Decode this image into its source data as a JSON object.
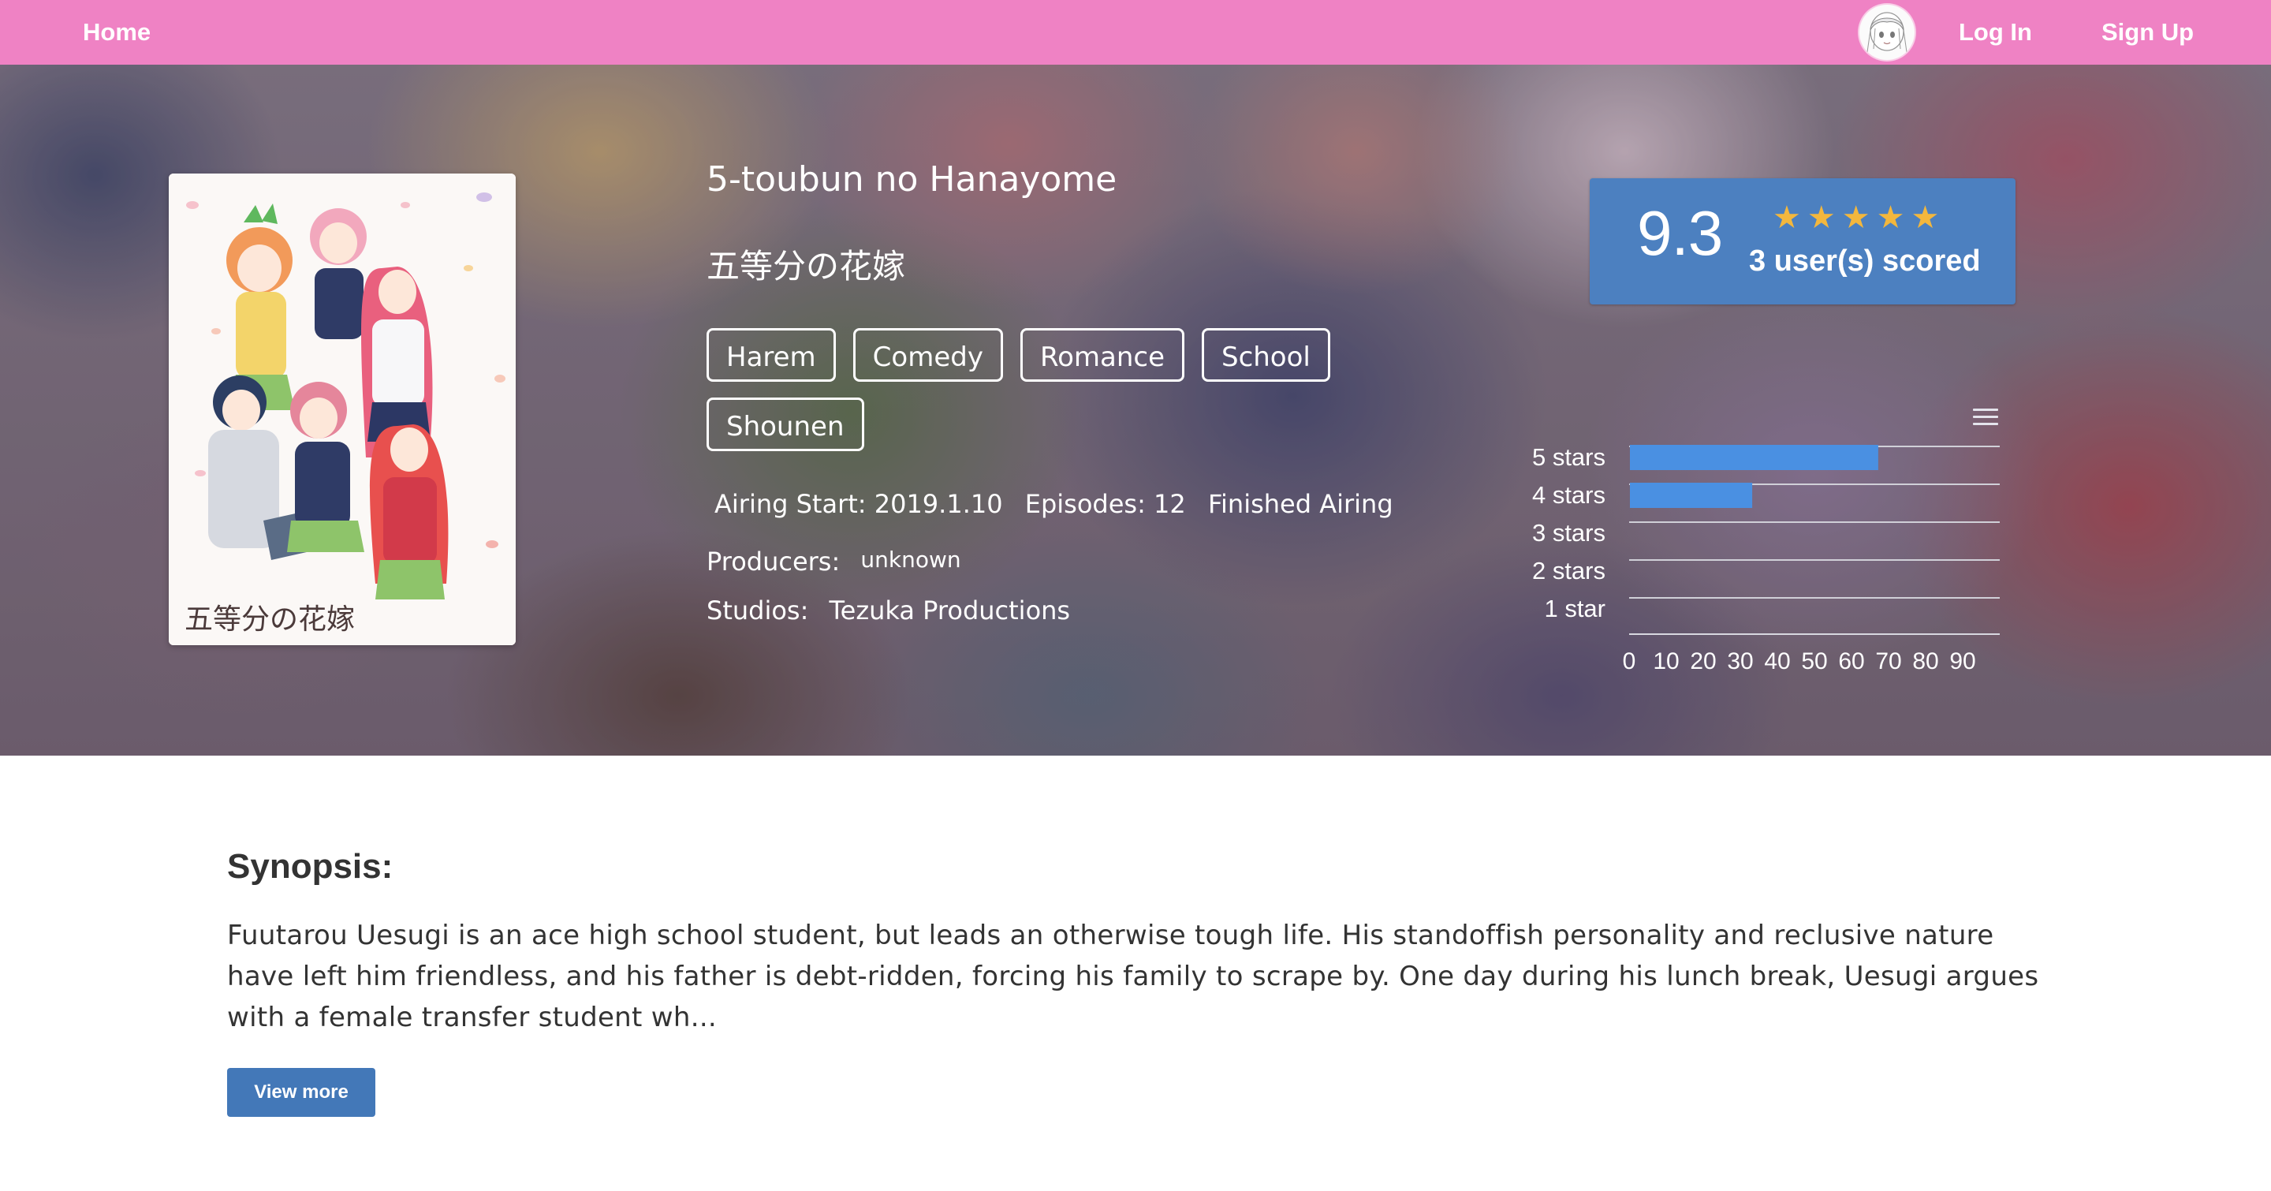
{
  "nav": {
    "home": "Home",
    "login": "Log In",
    "signup": "Sign Up"
  },
  "anime": {
    "title_en": "5-toubun no Hanayome",
    "title_jp": "五等分の花嫁",
    "poster_caption": "五等分の花嫁",
    "genres": [
      "Harem",
      "Comedy",
      "Romance",
      "School",
      "Shounen"
    ],
    "airing_start": "Airing Start: 2019.1.10",
    "episodes": "Episodes: 12",
    "status": "Finished Airing",
    "producers_label": "Producers:",
    "producers_value": "unknown",
    "studios_label": "Studios:",
    "studios_value": "Tezuka Productions"
  },
  "score": {
    "value": "9.3",
    "users": "3 user(s) scored",
    "stars": 5
  },
  "chart_data": {
    "type": "bar",
    "orientation": "horizontal",
    "categories": [
      "5 stars",
      "4 stars",
      "3 stars",
      "2 stars",
      "1 star"
    ],
    "values": [
      67,
      33,
      0,
      0,
      0
    ],
    "xticks": [
      "0",
      "10",
      "20",
      "30",
      "40",
      "50",
      "60",
      "70",
      "80",
      "90"
    ],
    "xlim": [
      0,
      100
    ],
    "grid": true,
    "color": "#4a90e2"
  },
  "synopsis": {
    "heading": "Synopsis:",
    "text": "Fuutarou Uesugi is an ace high school student, but leads an otherwise tough life. His standoffish personality and reclusive nature have left him friendless, and his father is debt-ridden, forcing his family to scrape by. One day during his lunch break, Uesugi argues with a female transfer student wh...",
    "button": "View more"
  },
  "colors": {
    "nav_bg": "#ef82c4",
    "score_card": "#4c80c0",
    "star": "#f3b73d",
    "button": "#4378b8"
  },
  "icons": {
    "avatar": "user-avatar-icon",
    "chart_menu": "hamburger-menu-icon",
    "star": "star-icon"
  }
}
